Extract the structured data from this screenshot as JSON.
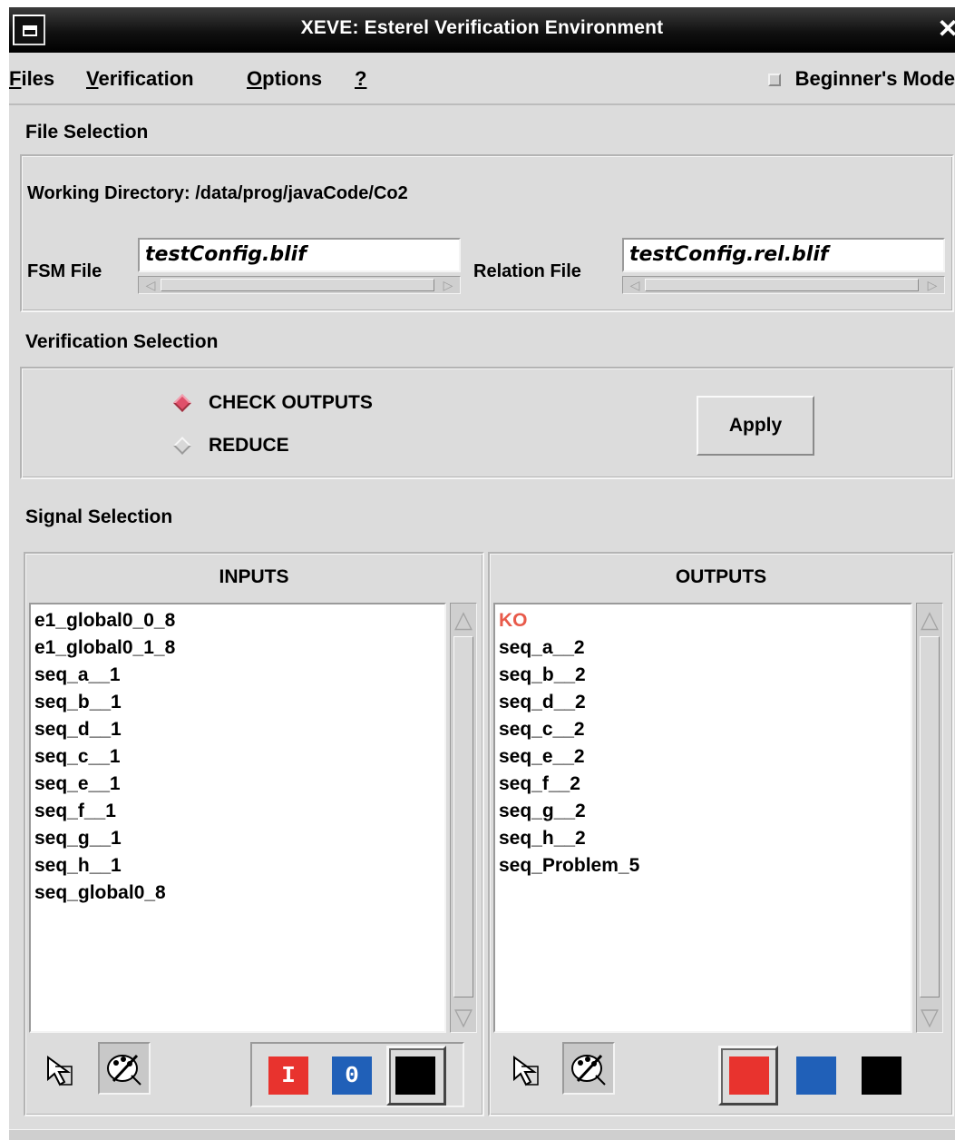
{
  "window": {
    "title": "XEVE: Esterel Verification Environment",
    "close_glyph": "✕"
  },
  "menubar": {
    "files_first": "F",
    "files_rest": "iles",
    "verification_first": "V",
    "verification_rest": "erification",
    "options_first": "O",
    "options_rest": "ptions",
    "help": "?",
    "beginner_mode": "Beginner's Mode"
  },
  "file_selection": {
    "heading": "File Selection",
    "working_directory_label": "Working Directory:",
    "working_directory_value": "/data/prog/javaCode/Co2",
    "fsm_label": "FSM File",
    "fsm_value": "testConfig.blif",
    "relation_label": "Relation File",
    "relation_value": "testConfig.rel.blif"
  },
  "verification_selection": {
    "heading": "Verification Selection",
    "options": [
      {
        "label": "CHECK OUTPUTS",
        "selected": true
      },
      {
        "label": "REDUCE",
        "selected": false
      }
    ],
    "apply_label": "Apply"
  },
  "signal_selection": {
    "heading": "Signal Selection",
    "inputs": {
      "header": "INPUTS",
      "items": [
        "e1_global0_0_8",
        "e1_global0_1_8",
        "seq_a__1",
        "seq_b__1",
        "seq_d__1",
        "seq_c__1",
        "seq_e__1",
        "seq_f__1",
        "seq_g__1",
        "seq_h__1",
        "seq_global0_8"
      ],
      "swatches": [
        {
          "color": "#e8332e",
          "glyph": "I"
        },
        {
          "color": "#2060b8",
          "glyph": "0"
        },
        {
          "color": "#000000",
          "glyph": ""
        }
      ]
    },
    "outputs": {
      "header": "OUTPUTS",
      "items": [
        "KO",
        "seq_a__2",
        "seq_b__2",
        "seq_d__2",
        "seq_c__2",
        "seq_e__2",
        "seq_f__2",
        "seq_g__2",
        "seq_h__2",
        "seq_Problem_5"
      ],
      "highlight_color": "#e85a4a",
      "swatches": [
        {
          "color": "#e8332e"
        },
        {
          "color": "#2060b8"
        },
        {
          "color": "#000000"
        }
      ]
    },
    "icons": [
      "pointer-arrow-icon",
      "palette-brush-icon"
    ]
  }
}
